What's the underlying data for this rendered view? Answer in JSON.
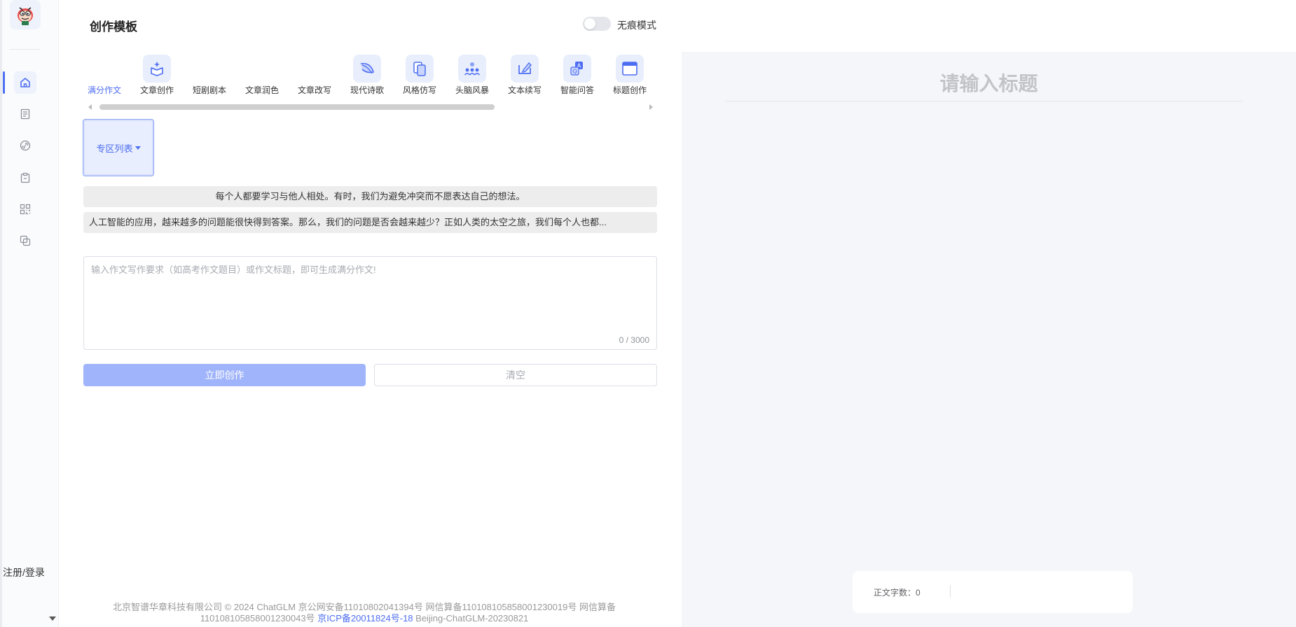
{
  "header": {
    "title": "创作模板",
    "traceless_toggle_label": "无痕模式",
    "traceless_enabled": false
  },
  "sidebar": {
    "items": [
      {
        "icon": "home-icon",
        "active": true
      },
      {
        "icon": "document-list-icon",
        "active": false
      },
      {
        "icon": "link-icon",
        "active": false
      },
      {
        "icon": "clipboard-icon",
        "active": false
      },
      {
        "icon": "grid-apps-icon",
        "active": false
      },
      {
        "icon": "copy-squares-icon",
        "active": false
      }
    ],
    "login_label": "注册/登录"
  },
  "templates": [
    {
      "label": "满分作文",
      "active": true,
      "icon": ""
    },
    {
      "label": "文章创作",
      "active": false,
      "icon": "box-sparkle-icon"
    },
    {
      "label": "短剧剧本",
      "active": false,
      "icon": ""
    },
    {
      "label": "文章润色",
      "active": false,
      "icon": ""
    },
    {
      "label": "文章改写",
      "active": false,
      "icon": ""
    },
    {
      "label": "现代诗歌",
      "active": false,
      "icon": "feather-icon"
    },
    {
      "label": "风格仿写",
      "active": false,
      "icon": "pages-icon"
    },
    {
      "label": "头脑风暴",
      "active": false,
      "icon": "people-idea-icon"
    },
    {
      "label": "文本续写",
      "active": false,
      "icon": "edit-box-icon"
    },
    {
      "label": "智能问答",
      "active": false,
      "icon": "qa-cards-icon"
    },
    {
      "label": "标题创作",
      "active": false,
      "icon": "window-title-icon"
    }
  ],
  "zone": {
    "label": "专区列表"
  },
  "samples": [
    "每个人都要学习与他人相处。有时，我们为避免冲突而不愿表达自己的想法。",
    "人工智能的应用，越来越多的问题能很快得到答案。那么，我们的问题是否会越来越少？正如人类的太空之旅，我们每个人也都..."
  ],
  "prompt": {
    "placeholder": "输入作文写作要求（如高考作文题目）或作文标题，即可生成满分作文!",
    "value": "",
    "counter": "0 / 3000"
  },
  "actions": {
    "create_label": "立即创作",
    "clear_label": "清空"
  },
  "footer": {
    "line1": "北京智谱华章科技有限公司 © 2024 ChatGLM 京公网安备11010802041394号 网信算备110108105858001230019号 网信算备",
    "line2_prefix": "110108105858001230043号",
    "icp_link": "京ICP备20011824号-18",
    "line2_suffix": "Beijing-ChatGLM-20230821"
  },
  "preview": {
    "title_placeholder": "请输入标题",
    "word_count_label": "正文字数：0"
  },
  "colors": {
    "accent": "#4e6ef2",
    "accent_light": "#e8eefc",
    "button_disabled": "#a0b4fb",
    "panel_bg": "#f5f6fa"
  }
}
